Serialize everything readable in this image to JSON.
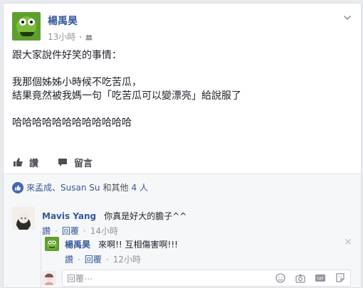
{
  "post": {
    "author": "楊禹昊",
    "time": "13小時",
    "lines": [
      "跟大家說件好笑的事情：",
      "",
      "我那個姊姊小時候不吃苦瓜，",
      "結果竟然被我媽一句「吃苦瓜可以變漂亮」給說服了",
      "",
      "哈哈哈哈哈哈哈哈哈哈哈哈"
    ]
  },
  "actions": {
    "like": "讚",
    "comment": "留言"
  },
  "likes": {
    "names": "來孟成、Susan Su",
    "connector": "和其他",
    "count_text": "4 人"
  },
  "comments": [
    {
      "author": "Mavis Yang",
      "text": "你真是好大的膽子^^",
      "like": "讚",
      "reply": "回覆",
      "time": "14小時"
    },
    {
      "author": "楊禹昊",
      "text": "來啊!! 互相傷害啊!!!",
      "like": "讚",
      "reply": "回覆",
      "time": "12小時"
    }
  ],
  "reply_box": {
    "placeholder": "回覆⋯"
  },
  "icons": {
    "like": "thumbs-up-icon",
    "comment": "speech-bubble-icon",
    "menu": "chevron-down-icon",
    "privacy": "friends-icon",
    "emoji": "smiley-icon",
    "camera": "camera-icon",
    "gif": "gif-icon",
    "sticker": "sticker-icon",
    "close": "close-icon"
  },
  "colors": {
    "link": "#365899",
    "meta": "#90949c",
    "text": "#1d2129",
    "bg": "#f6f7f9",
    "like_blue": "#4267b2"
  }
}
